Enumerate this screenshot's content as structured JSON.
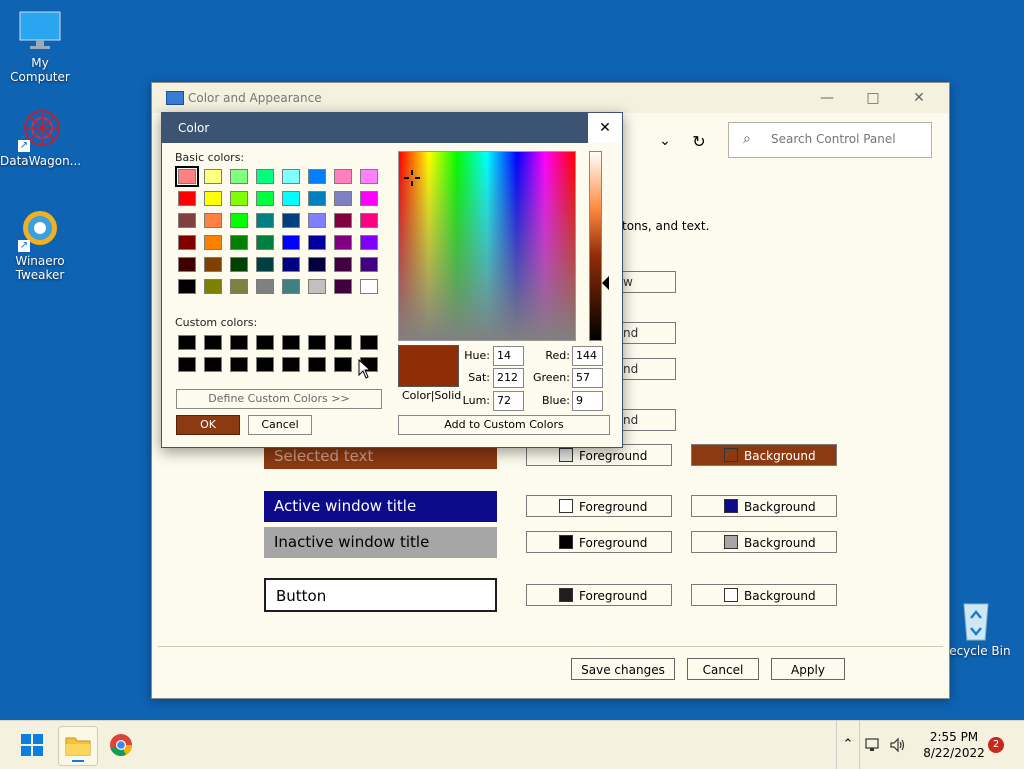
{
  "desktop": {
    "icons": [
      {
        "label": "My Computer"
      },
      {
        "label": "DataWagon..."
      },
      {
        "label": "Winaero Tweaker"
      },
      {
        "label": "Recycle Bin"
      }
    ]
  },
  "window": {
    "title": "Color and Appearance",
    "search_placeholder": "Search Control Panel",
    "description_fragment": "tons, and text.",
    "stub_buttons": [
      "w",
      "nd",
      "nd",
      "nd"
    ],
    "rows": [
      {
        "sample": "Selected text",
        "fg": "Foreground",
        "bg": "Background",
        "sample_bg": "#8c3a12",
        "sample_fg": "#c9a08a",
        "fg_color": "#e6e6e6",
        "bg_color": "#8c3a12",
        "bg_active": true
      },
      {
        "sample": "Active window title",
        "fg": "Foreground",
        "bg": "Background",
        "sample_bg": "#0c0c8a",
        "sample_fg": "#ffffff",
        "fg_color": "#ffffff",
        "bg_color": "#0c0c8a",
        "bg_active": false
      },
      {
        "sample": "Inactive window title",
        "fg": "Foreground",
        "bg": "Background",
        "sample_bg": "#a6a6a6",
        "sample_fg": "#000000",
        "fg_color": "#000000",
        "bg_color": "#a6a6a6",
        "bg_active": false
      },
      {
        "sample": "Button",
        "fg": "Foreground",
        "bg": "Background",
        "sample_bg": "#ffffff",
        "sample_fg": "#000000",
        "fg_color": "#1e1e1e",
        "bg_color": "#ffffff",
        "bg_active": false
      }
    ],
    "footer": {
      "save": "Save changes",
      "cancel": "Cancel",
      "apply": "Apply"
    }
  },
  "color_dialog": {
    "title": "Color",
    "basic_label": "Basic colors:",
    "custom_label": "Custom colors:",
    "define_custom": "Define Custom Colors >>",
    "ok": "OK",
    "cancel": "Cancel",
    "add_custom": "Add to Custom Colors",
    "preview_label": "Color|Solid",
    "hue_label": "Hue:",
    "hue": "14",
    "sat_label": "Sat:",
    "sat": "212",
    "lum_label": "Lum:",
    "lum": "72",
    "red_label": "Red:",
    "red": "144",
    "green_label": "Green:",
    "green": "57",
    "blue_label": "Blue:",
    "blue": "9",
    "basic_colors": [
      "#ff8080",
      "#ffff80",
      "#80ff80",
      "#00ff80",
      "#80ffff",
      "#0080ff",
      "#ff80c0",
      "#ff80ff",
      "#ff0000",
      "#ffff00",
      "#80ff00",
      "#00ff40",
      "#00ffff",
      "#0080c0",
      "#8080c0",
      "#ff00ff",
      "#804040",
      "#ff8040",
      "#00ff00",
      "#008080",
      "#004080",
      "#8080ff",
      "#800040",
      "#ff0080",
      "#800000",
      "#ff8000",
      "#008000",
      "#008040",
      "#0000ff",
      "#0000a0",
      "#800080",
      "#8000ff",
      "#400000",
      "#804000",
      "#004000",
      "#004040",
      "#000080",
      "#000040",
      "#400040",
      "#400080",
      "#000000",
      "#808000",
      "#808040",
      "#808080",
      "#408080",
      "#c0c0c0",
      "#400040",
      "#ffffff"
    ],
    "custom_colors": [
      "#000000",
      "#000000",
      "#000000",
      "#000000",
      "#000000",
      "#000000",
      "#000000",
      "#000000",
      "#000000",
      "#000000",
      "#000000",
      "#000000",
      "#000000",
      "#000000",
      "#000000",
      "#000000"
    ]
  },
  "taskbar": {
    "time": "2:55 PM",
    "date": "8/22/2022",
    "notifications": "2"
  }
}
